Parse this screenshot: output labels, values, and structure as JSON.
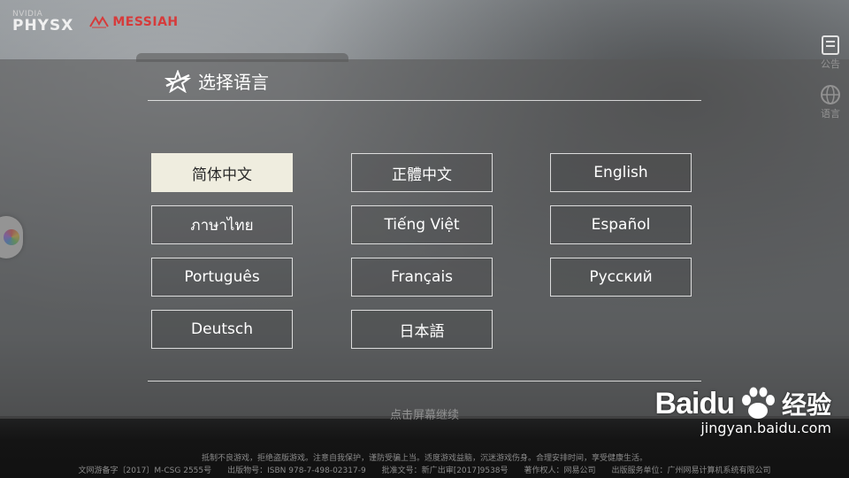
{
  "brand": {
    "nvidia_small": "NVIDIA",
    "nvidia_big": "PHYSX",
    "engine": "MESSIAH"
  },
  "side_menu": [
    {
      "label": "公告",
      "icon": "notice-icon"
    },
    {
      "label": "语言",
      "icon": "globe-icon"
    }
  ],
  "dialog": {
    "title": "选择语言",
    "icon": "game-logo-icon"
  },
  "languages": [
    {
      "label": "简体中文",
      "selected": true
    },
    {
      "label": "正體中文",
      "selected": false
    },
    {
      "label": "English",
      "selected": false
    },
    {
      "label": "ภาษาไทย",
      "selected": false
    },
    {
      "label": "Tiếng Việt",
      "selected": false
    },
    {
      "label": "Español",
      "selected": false
    },
    {
      "label": "Português",
      "selected": false
    },
    {
      "label": "Français",
      "selected": false
    },
    {
      "label": "Русский",
      "selected": false
    },
    {
      "label": "Deutsch",
      "selected": false
    },
    {
      "label": "日本語",
      "selected": false
    }
  ],
  "hint": "点击屏幕继续",
  "footer": {
    "line1": "抵制不良游戏，拒绝盗版游戏。注意自我保护，谨防受骗上当。适度游戏益脑，沉迷游戏伤身。合理安排时间，享受健康生活。",
    "line2": "文网游备字〔2017〕M-CSG 2555号　　出版物号：ISBN 978-7-498-02317-9　　批准文号：新广出审[2017]9538号　　著作权人：网易公司　　出版服务单位：广州网易计算机系统有限公司"
  },
  "watermark": {
    "brand": "Baidu",
    "cn": "经验",
    "url": "jingyan.baidu.com"
  },
  "colors": {
    "selected_bg": "#efeddf",
    "engine_red": "#d63b3b"
  }
}
